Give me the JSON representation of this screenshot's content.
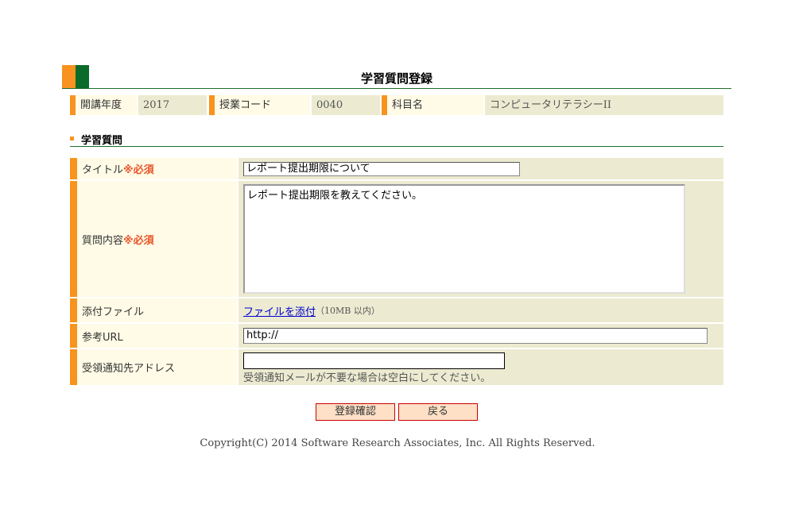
{
  "page": {
    "title": "学習質問登録"
  },
  "info": {
    "year_label": "開講年度",
    "year_value": "2017",
    "code_label": "授業コード",
    "code_value": "0040",
    "subject_label": "科目名",
    "subject_value": "コンピュータリテラシーII"
  },
  "section": {
    "title": "学習質問"
  },
  "form": {
    "title_label": "タイトル",
    "content_label": "質問内容",
    "required_mark": "※必須",
    "title_value": "レポート提出期限について",
    "content_value": "レポート提出期限を教えてください。",
    "attach_label": "添付ファイル",
    "attach_link": "ファイルを添付",
    "attach_note": "（10MB 以内）",
    "url_label": "参考URL",
    "url_value": "http://",
    "email_label": "受領通知先アドレス",
    "email_value": "",
    "email_note": "受領通知メールが不要な場合は空白にしてください。"
  },
  "buttons": {
    "confirm": "登録確認",
    "back": "戻る"
  },
  "footer": {
    "copyright": "Copyright(C) 2014 Software Research Associates, Inc. All Rights Reserved."
  },
  "colors": {
    "accent_orange": "#f7931e",
    "accent_green": "#0a6b2a",
    "label_bg": "#fffbe6",
    "value_bg": "#ecebd1",
    "required": "#e8542a"
  }
}
